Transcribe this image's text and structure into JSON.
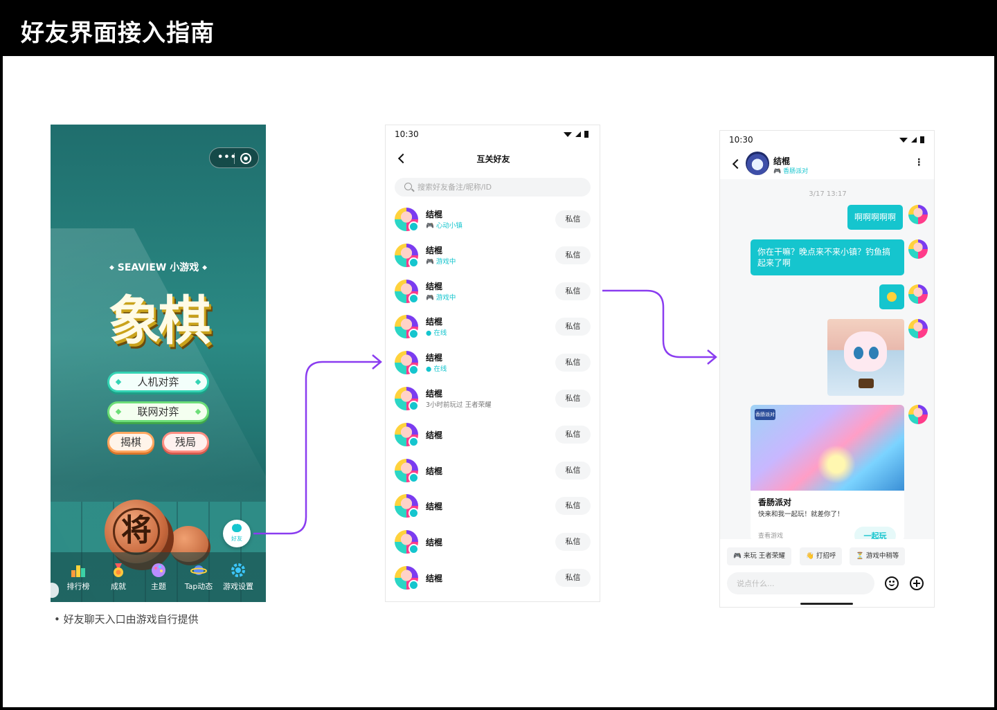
{
  "header": {
    "title": "好友界面接入指南"
  },
  "game_screen": {
    "subtitle": "SEAVIEW 小游戏",
    "title": "象棋",
    "buttons": [
      "人机对弈",
      "联网对弈",
      "揭棋",
      "残局"
    ],
    "chess_piece": "将",
    "friend_entry_label": "好友",
    "tabs": [
      "排行榜",
      "成就",
      "主题",
      "Tap动态",
      "游戏设置"
    ]
  },
  "caption": "• 好友聊天入口由游戏自行提供",
  "friend_list": {
    "status_time": "10:30",
    "title": "互关好友",
    "search_placeholder": "搜索好友备注/昵称/ID",
    "message_label": "私信",
    "rows": [
      {
        "name": "结棍",
        "status": "心动小镇",
        "status_icon": "gamepad-icon"
      },
      {
        "name": "结棍",
        "status": "游戏中",
        "status_icon": "gamepad-icon"
      },
      {
        "name": "结棍",
        "status": "游戏中",
        "status_icon": "gamepad-icon"
      },
      {
        "name": "结棍",
        "status": "在线",
        "status_icon": "online-dot-icon"
      },
      {
        "name": "结棍",
        "status": "在线",
        "status_icon": "online-dot-icon"
      },
      {
        "name": "结棍",
        "status": "3小时前玩过 王者荣耀",
        "status_icon": ""
      },
      {
        "name": "结棍",
        "status": "",
        "status_icon": ""
      },
      {
        "name": "结棍",
        "status": "",
        "status_icon": ""
      },
      {
        "name": "结棍",
        "status": "",
        "status_icon": ""
      },
      {
        "name": "结棍",
        "status": "",
        "status_icon": ""
      },
      {
        "name": "结棍",
        "status": "",
        "status_icon": ""
      }
    ]
  },
  "chat": {
    "status_time": "10:30",
    "contact_name": "结棍",
    "contact_game": "香肠派对",
    "timestamp": "3/17  13:17",
    "messages": [
      "啊啊啊啊啊",
      "你在干嘛？晚点来不来小镇？钓鱼搞起来了啊"
    ],
    "card": {
      "title": "香肠派对",
      "description": "快来和我一起玩！就差你了！",
      "link": "查看游戏",
      "button": "一起玩",
      "logo_text": "香肠派对"
    },
    "quick_replies": [
      {
        "icon": "gamepad-icon",
        "label": "来玩 王者荣耀"
      },
      {
        "icon": "wave-hand-icon",
        "label": "打招呼"
      },
      {
        "icon": "hourglass-icon",
        "label": "游戏中稍等"
      }
    ],
    "input_placeholder": "说点什么..."
  },
  "colors": {
    "accent": "#15c5ce",
    "arrow": "#8a3cf0"
  }
}
